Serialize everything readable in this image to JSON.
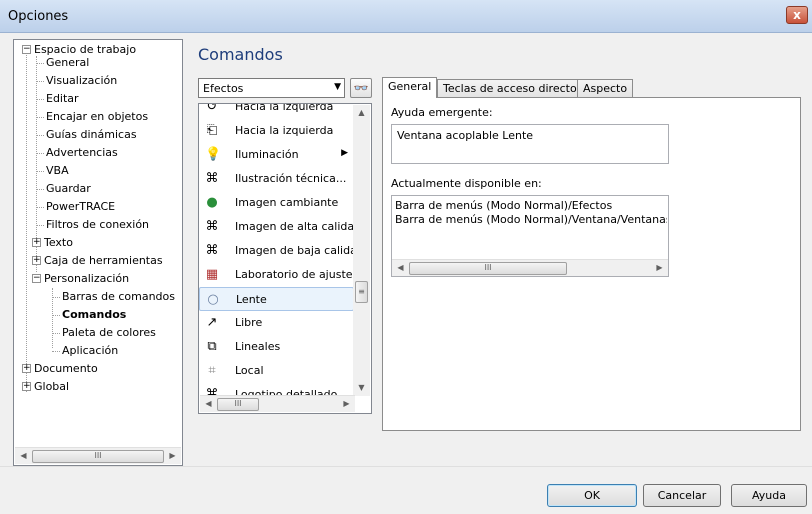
{
  "window": {
    "title": "Opciones",
    "close_glyph": "x"
  },
  "tree": {
    "items": [
      {
        "label": "Espacio de trabajo"
      },
      {
        "label": "General"
      },
      {
        "label": "Visualización"
      },
      {
        "label": "Editar"
      },
      {
        "label": "Encajar en objetos"
      },
      {
        "label": "Guías dinámicas"
      },
      {
        "label": "Advertencias"
      },
      {
        "label": "VBA"
      },
      {
        "label": "Guardar"
      },
      {
        "label": "PowerTRACE"
      },
      {
        "label": "Filtros de conexión"
      },
      {
        "label": "Texto"
      },
      {
        "label": "Caja de herramientas"
      },
      {
        "label": "Personalización"
      },
      {
        "label": "Barras de comandos"
      },
      {
        "label": "Comandos"
      },
      {
        "label": "Paleta de colores"
      },
      {
        "label": "Aplicación"
      },
      {
        "label": "Documento"
      },
      {
        "label": "Global"
      }
    ],
    "scroll_thumb": "III"
  },
  "main": {
    "title": "Comandos",
    "category_dropdown": {
      "value": "Efectos"
    },
    "commands": [
      {
        "label": "Hacia la izquierda",
        "icon": "arrow-left-icon"
      },
      {
        "label": "Hacia la izquierda",
        "icon": "window-left-icon"
      },
      {
        "label": "Iluminación",
        "icon": "lightbulb-icon",
        "submenu": true
      },
      {
        "label": "Ilustración técnica...",
        "icon": "technical-illustration-icon"
      },
      {
        "label": "Imagen cambiante",
        "icon": "sphere-icon"
      },
      {
        "label": "Imagen de alta calidad",
        "icon": "high-quality-image-icon"
      },
      {
        "label": "Imagen de baja calidad",
        "icon": "low-quality-image-icon"
      },
      {
        "label": "Laboratorio de ajuste",
        "icon": "adjustment-lab-icon"
      },
      {
        "label": "Lente",
        "icon": "lens-icon",
        "selected": true
      },
      {
        "label": "Libre",
        "icon": "freehand-icon"
      },
      {
        "label": "Lineales",
        "icon": "linear-icon"
      },
      {
        "label": "Local",
        "icon": "local-icon"
      },
      {
        "label": "Logotipo detallado",
        "icon": "logo-icon"
      }
    ],
    "list_thumb": "III"
  },
  "tabs": [
    {
      "label": "General",
      "active": true
    },
    {
      "label": "Teclas de acceso directo"
    },
    {
      "label": "Aspecto"
    }
  ],
  "general_tab": {
    "tooltip_label": "Ayuda emergente:",
    "tooltip_value": "Ventana acoplable Lente",
    "available_label": "Actualmente disponible en:",
    "available_items": [
      "Barra de menús (Modo Normal)/Efectos",
      "Barra de menús (Modo Normal)/Ventana/Ventanas acoplables/Lente"
    ],
    "scroll_thumb": "III"
  },
  "footer": {
    "ok": "OK",
    "cancel": "Cancelar",
    "help": "Ayuda"
  },
  "colors": {
    "title_blue": "#1e3d7b",
    "selection": "#eaf3fc"
  }
}
